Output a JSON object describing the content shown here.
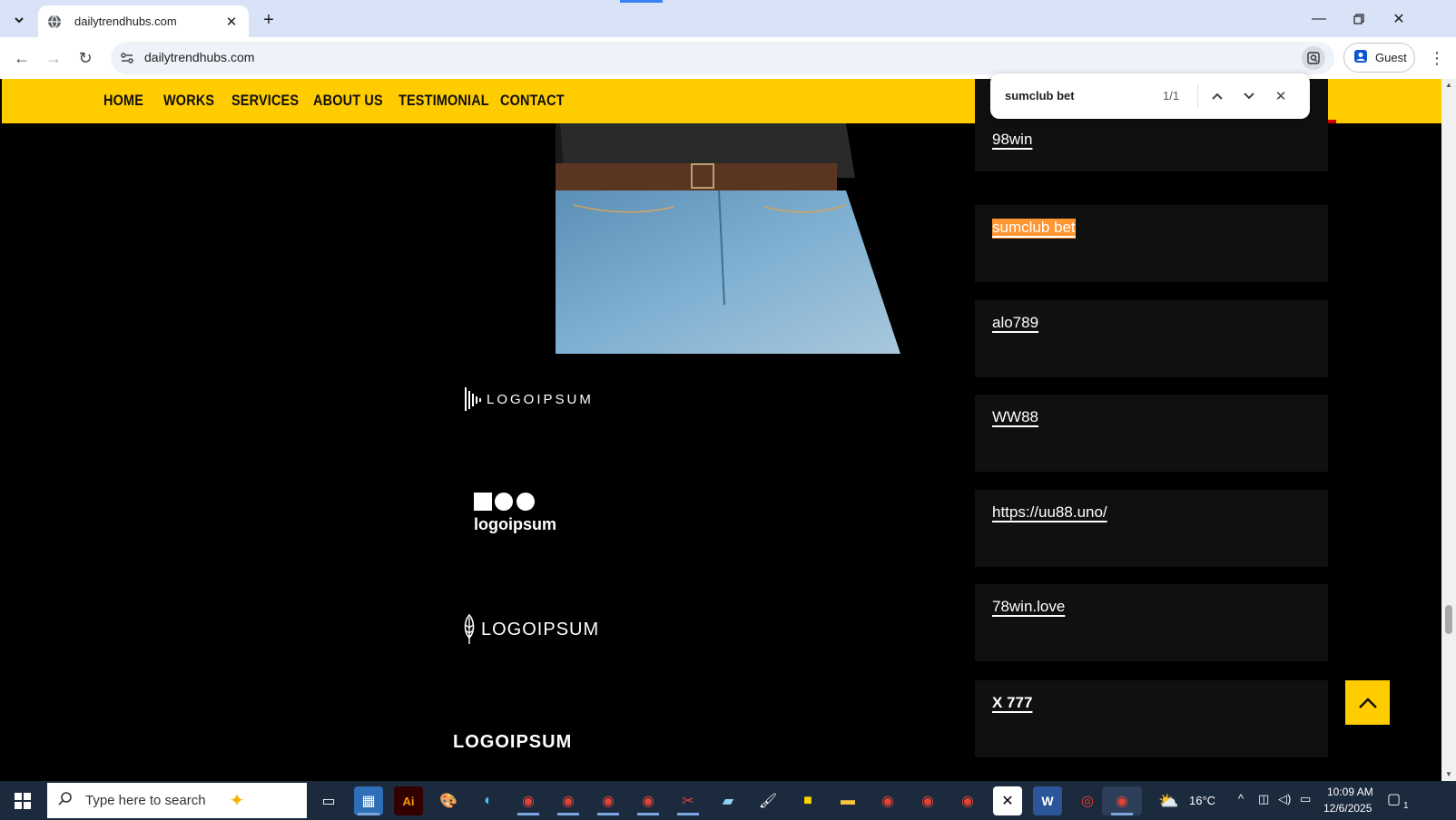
{
  "browser": {
    "tab_title": "dailytrendhubs.com",
    "url": "dailytrendhubs.com",
    "profile_label": "Guest"
  },
  "site": {
    "nav": [
      {
        "label": "HOME"
      },
      {
        "label": "WORKS"
      },
      {
        "label": "SERVICES"
      },
      {
        "label": "ABOUT US"
      },
      {
        "label": "TESTIMONIAL"
      },
      {
        "label": "CONTACT"
      }
    ],
    "logos": [
      "LOGOIPSUM",
      "logoipsum",
      "LOGOIPSUM",
      "LOGOIPSUM"
    ],
    "links": [
      {
        "label": "98win",
        "highlighted": false
      },
      {
        "label": "sumclub bet",
        "highlighted": true
      },
      {
        "label": "alo789",
        "highlighted": false
      },
      {
        "label": "WW88",
        "highlighted": false
      },
      {
        "label": "https://uu88.uno/",
        "highlighted": false
      },
      {
        "label": "78win.love",
        "highlighted": false
      },
      {
        "label": "X 777",
        "highlighted": false
      }
    ],
    "accent_color": "#ffcc00",
    "highlight_color": "#ff9632"
  },
  "find_bar": {
    "query": "sumclub bet",
    "count": "1/1"
  },
  "taskbar": {
    "search_placeholder": "Type here to search",
    "weather": "16°C",
    "time": "10:09 AM",
    "date": "12/6/2025",
    "notification_count": "1"
  }
}
